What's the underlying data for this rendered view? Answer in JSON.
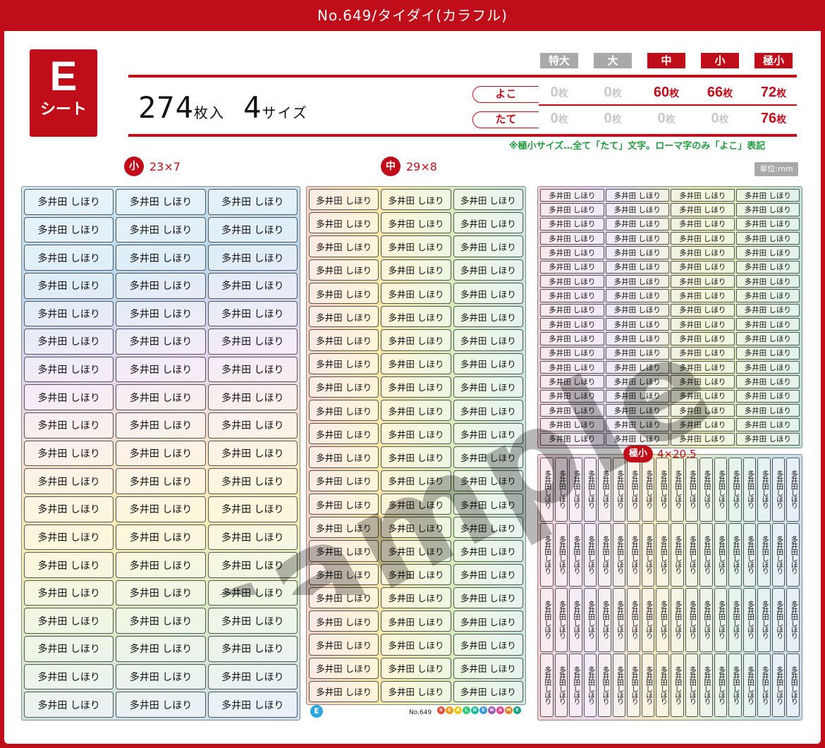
{
  "header": {
    "title": "No.649/タイダイ(カラフル)"
  },
  "sheet": {
    "letter": "E",
    "word": "シート"
  },
  "summary": {
    "count_num": "274",
    "count_unit": "枚入",
    "sizes_num": "4",
    "sizes_unit": "サイズ"
  },
  "size_headers": [
    {
      "label": "特大",
      "active": false
    },
    {
      "label": "大",
      "active": false
    },
    {
      "label": "中",
      "active": true
    },
    {
      "label": "小",
      "active": true
    },
    {
      "label": "極小",
      "active": true
    }
  ],
  "rows": [
    {
      "label": "よこ",
      "cells": [
        {
          "num": "0",
          "unit": "枚",
          "active": false
        },
        {
          "num": "0",
          "unit": "枚",
          "active": false
        },
        {
          "num": "60",
          "unit": "枚",
          "active": true
        },
        {
          "num": "66",
          "unit": "枚",
          "active": true
        },
        {
          "num": "72",
          "unit": "枚",
          "active": true
        }
      ]
    },
    {
      "label": "たて",
      "cells": [
        {
          "num": "0",
          "unit": "枚",
          "active": false
        },
        {
          "num": "0",
          "unit": "枚",
          "active": false
        },
        {
          "num": "0",
          "unit": "枚",
          "active": false
        },
        {
          "num": "0",
          "unit": "枚",
          "active": false
        },
        {
          "num": "76",
          "unit": "枚",
          "active": true
        }
      ]
    }
  ],
  "note": "※極小サイズ…全て「たて」文字。ローマ字のみ「よこ」表記",
  "unit_label": "単位:mm",
  "label_small": {
    "badge": "小",
    "dims": "23×7"
  },
  "label_mid": {
    "badge": "中",
    "dims": "29×8"
  },
  "label_tiny": {
    "badge": "極小",
    "dims": "4×20.5"
  },
  "name_text": "多井田 しほり",
  "name_vertical": "多井田しほり",
  "footer": {
    "sheet_letter": "E",
    "product_no": "No.649",
    "brand_letters": [
      "S",
      "E",
      "A",
      "L",
      "D",
      "E",
      "N",
      "A",
      "M",
      "E"
    ],
    "brand_colors": [
      "#e94b3c",
      "#f39c12",
      "#f1c40f",
      "#2ecc71",
      "#1abc9c",
      "#3498db",
      "#9b59b6",
      "#e84393",
      "#e67e22",
      "#16a085"
    ]
  },
  "watermark": "sample"
}
